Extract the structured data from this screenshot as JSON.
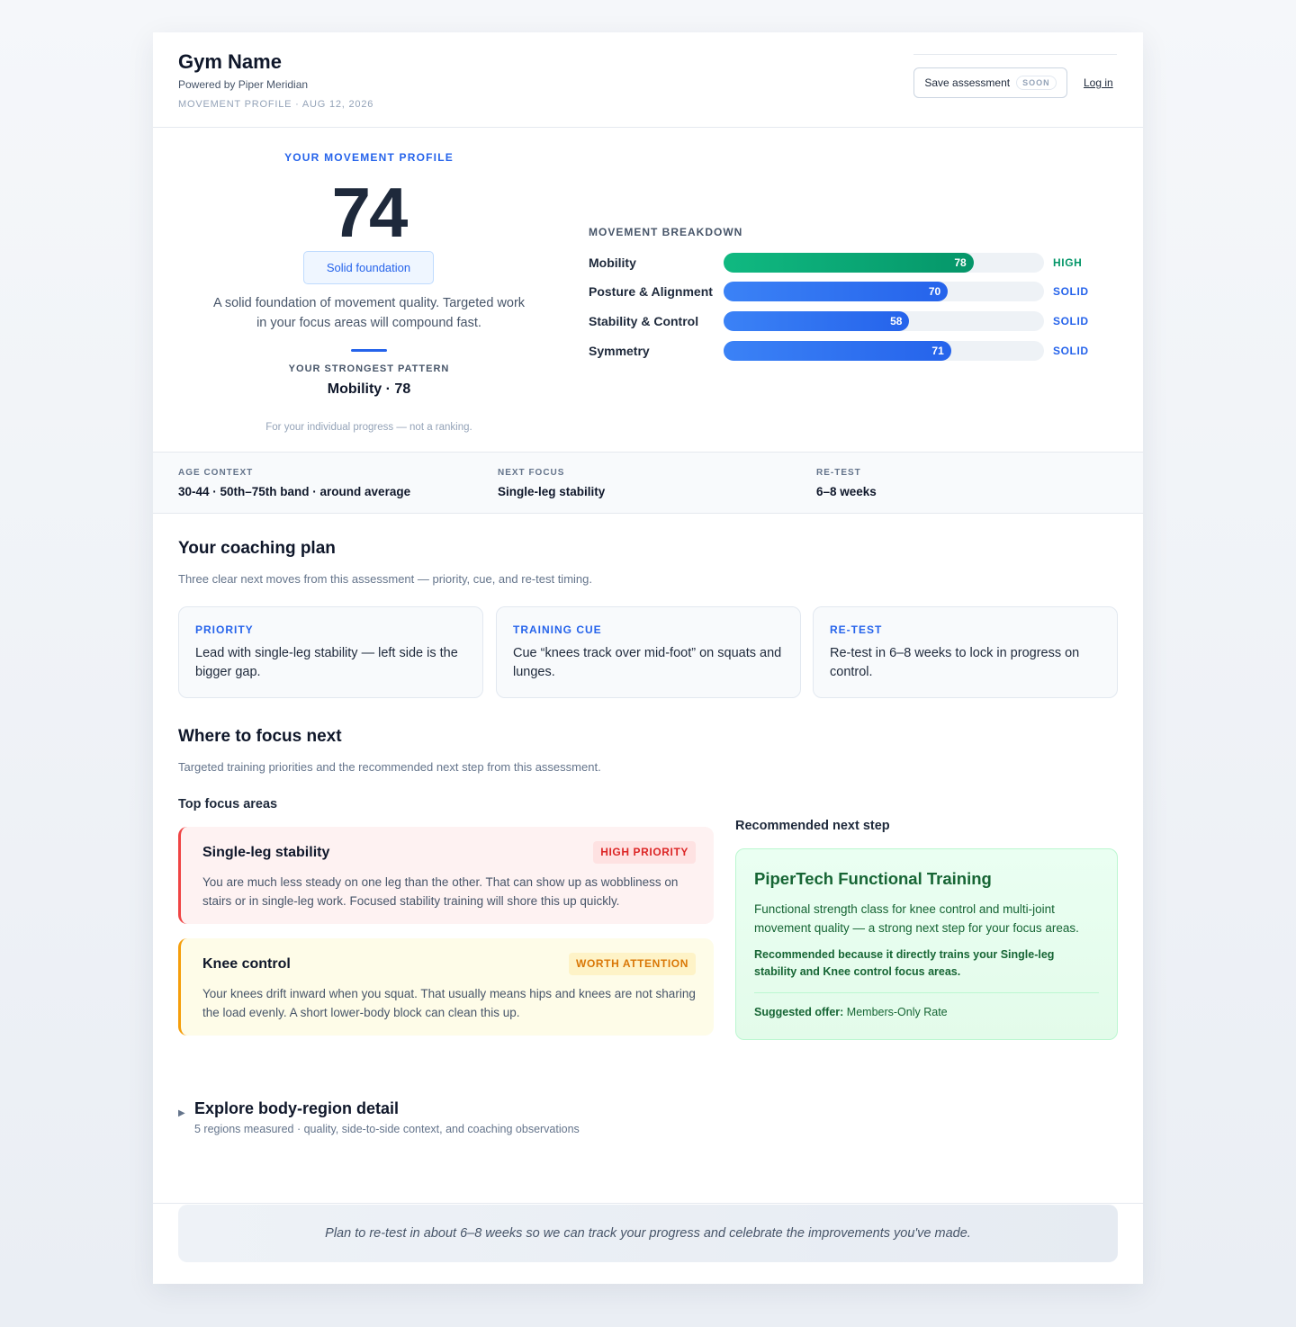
{
  "header": {
    "gym_name": "Gym Name",
    "powered_by": "Powered by Piper Meridian",
    "meta": "MOVEMENT PROFILE · AUG 12, 2026",
    "save_label": "Save assessment",
    "soon_badge": "SOON",
    "login_label": "Log in"
  },
  "profile": {
    "eyebrow": "YOUR MOVEMENT PROFILE",
    "score": "74",
    "band": "Solid foundation",
    "description": "A solid foundation of movement quality. Targeted work in your focus areas will compound fast.",
    "strongest_label": "YOUR STRONGEST PATTERN",
    "strongest_value": "Mobility · 78",
    "note": "For your individual progress — not a ranking."
  },
  "breakdown": {
    "title": "MOVEMENT BREAKDOWN",
    "items": [
      {
        "label": "Mobility",
        "value": 78,
        "tier": "HIGH",
        "color": "#059669"
      },
      {
        "label": "Posture & Alignment",
        "value": 70,
        "tier": "SOLID",
        "color": "#2563eb"
      },
      {
        "label": "Stability & Control",
        "value": 58,
        "tier": "SOLID",
        "color": "#2563eb"
      },
      {
        "label": "Symmetry",
        "value": 71,
        "tier": "SOLID",
        "color": "#2563eb"
      }
    ]
  },
  "stats": [
    {
      "label": "AGE CONTEXT",
      "value": "30-44 · 50th–75th band · around average"
    },
    {
      "label": "NEXT FOCUS",
      "value": "Single-leg stability"
    },
    {
      "label": "RE-TEST",
      "value": "6–8 weeks"
    }
  ],
  "coaching": {
    "title": "Your coaching plan",
    "subtitle": "Three clear next moves from this assessment — priority, cue, and re-test timing.",
    "cards": [
      {
        "label": "PRIORITY",
        "text": "Lead with single-leg stability — left side is the bigger gap."
      },
      {
        "label": "TRAINING CUE",
        "text": "Cue “knees track over mid-foot” on squats and lunges."
      },
      {
        "label": "RE-TEST",
        "text": "Re-test in 6–8 weeks to lock in progress on control."
      }
    ]
  },
  "focus": {
    "title": "Where to focus next",
    "subtitle": "Targeted training priorities and the recommended next step from this assessment.",
    "areas_heading": "Top focus areas",
    "areas": [
      {
        "title": "Single-leg stability",
        "badge": "HIGH PRIORITY",
        "text": "You are much less steady on one leg than the other. That can show up as wobbliness on stairs or in single-leg work. Focused stability training will shore this up quickly."
      },
      {
        "title": "Knee control",
        "badge": "WORTH ATTENTION",
        "text": "Your knees drift inward when you squat. That usually means hips and knees are not sharing the load evenly. A short lower-body block can clean this up."
      }
    ],
    "recommend_heading": "Recommended next step",
    "recommendation": {
      "title": "PiperTech Functional Training",
      "description": "Functional strength class for knee control and multi-joint movement quality — a strong next step for your focus areas.",
      "why": "Recommended because it directly trains your Single-leg stability and Knee control focus areas.",
      "offer_label": "Suggested offer:",
      "offer_value": "Members-Only Rate"
    }
  },
  "explore": {
    "title": "Explore body-region detail",
    "subtitle": "5 regions measured · quality, side-to-side context, and coaching observations"
  },
  "footer": {
    "note": "Plan to re-test in about 6–8 weeks so we can track your progress and celebrate the improvements you've made."
  }
}
